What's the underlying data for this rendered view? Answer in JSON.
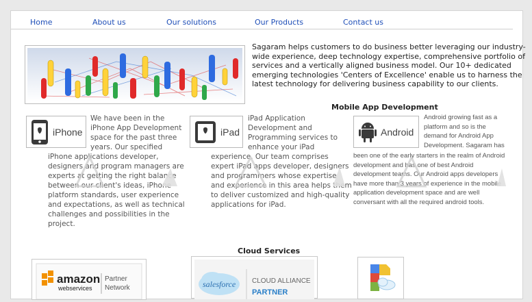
{
  "nav": {
    "items": [
      {
        "label": "Home"
      },
      {
        "label": "About us"
      },
      {
        "label": "Our solutions"
      },
      {
        "label": "Our Products"
      },
      {
        "label": "Contact us"
      }
    ]
  },
  "intro": {
    "lines": [
      "Sagaram helps customers to do business better leveraging our industry-",
      "wide experience, deep technology expertise, comprehensive portfolio of",
      "services and a vertically aligned business model. Our 10+ dedicated",
      "emerging technologies 'Centers of Excellence' enable us to harness the",
      "latest technology for delivering business capability to our clients."
    ]
  },
  "mobile": {
    "title": "Mobile App Development",
    "iphone": {
      "logo_label": "iPhone",
      "lines_right": [
        "We have been in the",
        "iPhone App Development",
        "space for the past three",
        "years. Our specified"
      ],
      "lines_full": [
        "iPhone applications developer,",
        "designers and program managers are",
        "experts at getting the right balance",
        "between our client's ideas, iPhone",
        "platform standards, user experience",
        "and expectations, as well as technical",
        "challenges and possibilities in the",
        "project."
      ]
    },
    "ipad": {
      "logo_label": "iPad",
      "lines_right": [
        "iPad Application",
        "Development and",
        "Programming services to",
        "enhance your iPad"
      ],
      "lines_full": [
        "experience. Our team comprises",
        "expert iPad apps developer, designers",
        "and programmers whose expertise",
        "and experience in this area helps them",
        "to deliver customized and high-quality",
        "applications for iPad."
      ]
    },
    "android": {
      "logo_label": "Android",
      "lines_right": [
        "Android  growing fast as a",
        "platform and so is the",
        "demand for Android App",
        "Development. Sagaram has"
      ],
      "lines_full": [
        "been one of the early starters in the realm of Android",
        "development and has one of best Android",
        "development teams. Our Android apps developers",
        "have more than 3 years of experience in the mobile",
        "application development space and are well",
        "conversant with all the required android tools."
      ]
    }
  },
  "cloud": {
    "title": "Cloud Services",
    "amazon": {
      "brand": "amazon",
      "sub": "webservices",
      "tag1": "Partner",
      "tag2": "Network"
    },
    "salesforce": {
      "brand": "salesforce",
      "tag1": "CLOUD ALLIANCE",
      "tag2": "PARTNER"
    },
    "google": {
      "name": "google-cloud-icon"
    }
  },
  "colors": {
    "nav_link": "#1f4fb8",
    "android_green": "#97c024"
  }
}
